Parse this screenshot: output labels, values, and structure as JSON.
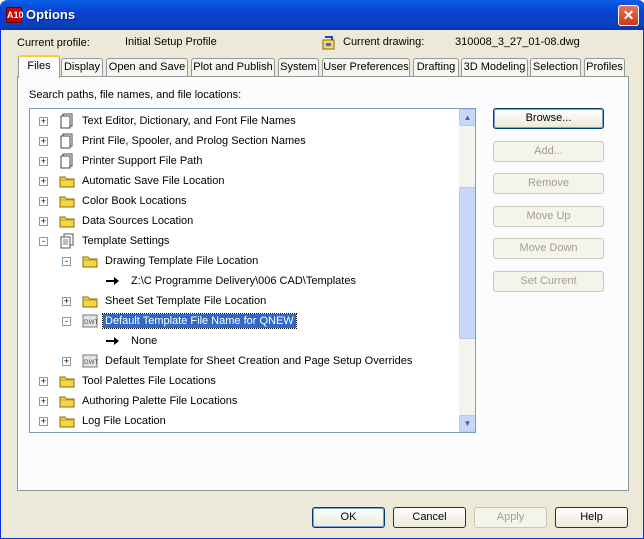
{
  "window": {
    "title": "Options",
    "app_icon_text": "A10",
    "close_label": "✕"
  },
  "profile": {
    "current_profile_label": "Current profile:",
    "current_profile_value": "Initial Setup Profile",
    "current_drawing_label": "Current drawing:",
    "current_drawing_value": "310008_3_27_01-08.dwg"
  },
  "tabs": [
    "Files",
    "Display",
    "Open and Save",
    "Plot and Publish",
    "System",
    "User Preferences",
    "Drafting",
    "3D Modeling",
    "Selection",
    "Profiles"
  ],
  "active_tab": "Files",
  "tree_caption": "Search paths, file names, and file locations:",
  "tree": [
    {
      "label": "Text Editor, Dictionary, and Font File Names",
      "expander": "+",
      "icon": "document-stack-icon"
    },
    {
      "label": "Print File, Spooler, and Prolog Section Names",
      "expander": "+",
      "icon": "document-stack-icon"
    },
    {
      "label": "Printer Support File Path",
      "expander": "+",
      "icon": "document-stack-icon"
    },
    {
      "label": "Automatic Save File Location",
      "expander": "+",
      "icon": "folder-icon"
    },
    {
      "label": "Color Book Locations",
      "expander": "+",
      "icon": "folder-icon"
    },
    {
      "label": "Data Sources Location",
      "expander": "+",
      "icon": "folder-icon"
    },
    {
      "label": "Template Settings",
      "expander": "−",
      "icon": "template-stack-icon"
    },
    {
      "label": "Drawing Template File Location",
      "expander": "−",
      "icon": "folder-icon"
    },
    {
      "label": "Z:\\C Programme Delivery\\006 CAD\\Templates",
      "expander": "",
      "icon": "arrow-icon"
    },
    {
      "label": "Sheet Set Template File Location",
      "expander": "+",
      "icon": "folder-icon"
    },
    {
      "label": "Default Template File Name for QNEW",
      "expander": "−",
      "icon": "dwt-file-icon",
      "selected": true
    },
    {
      "label": "None",
      "expander": "",
      "icon": "arrow-icon"
    },
    {
      "label": "Default Template for Sheet Creation and Page Setup Overrides",
      "expander": "+",
      "icon": "dwt-file-icon"
    },
    {
      "label": "Tool Palettes File Locations",
      "expander": "+",
      "icon": "folder-icon"
    },
    {
      "label": "Authoring Palette File Locations",
      "expander": "+",
      "icon": "folder-icon"
    },
    {
      "label": "Log File Location",
      "expander": "+",
      "icon": "folder-icon"
    }
  ],
  "side_buttons": {
    "browse": "Browse...",
    "add": "Add...",
    "remove": "Remove",
    "move_up": "Move Up",
    "move_down": "Move Down",
    "set_current": "Set Current"
  },
  "footer": {
    "ok": "OK",
    "cancel": "Cancel",
    "apply": "Apply",
    "help": "Help"
  },
  "colors": {
    "selection": "#316ac5",
    "titlebar": "#0a5fe8",
    "active_tab_accent": "#ffc83c"
  }
}
